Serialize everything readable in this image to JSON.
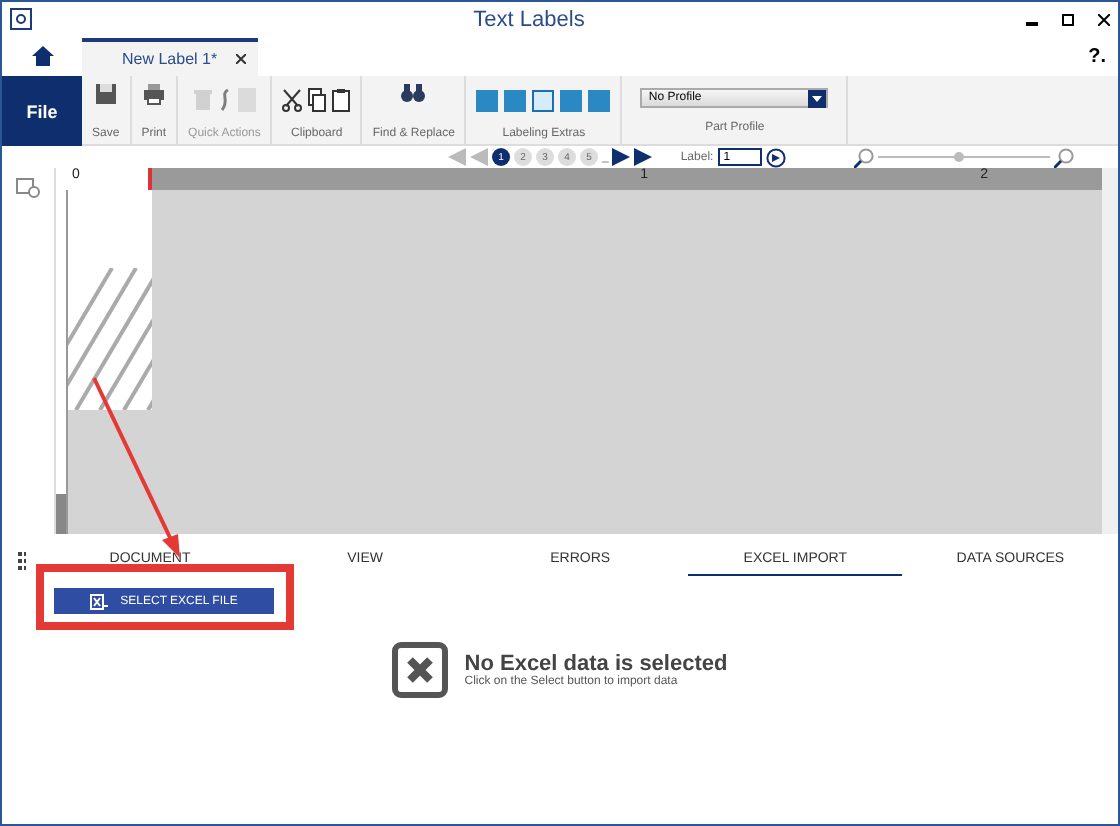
{
  "window": {
    "title": "Text Labels",
    "help": "?."
  },
  "doc_tabs": [
    {
      "label": "New Label 1*",
      "selected": true
    }
  ],
  "file_button": "File",
  "ribbon": [
    {
      "kind": "single",
      "label": "Save"
    },
    {
      "kind": "single",
      "label": "Print"
    },
    {
      "kind": "group",
      "label": "Quick Actions",
      "disabled": true
    },
    {
      "kind": "group",
      "label": "Clipboard",
      "disabled": false
    },
    {
      "kind": "single",
      "label": "Find & Replace"
    },
    {
      "kind": "extras",
      "label": "Labeling Extras",
      "items": [
        {
          "selected": false
        },
        {
          "selected": false
        },
        {
          "selected": true
        },
        {
          "selected": false
        },
        {
          "selected": false
        }
      ]
    },
    {
      "kind": "profile",
      "label": "Part Profile",
      "value": "No Profile"
    }
  ],
  "nav": {
    "pages": [
      {
        "label": "1",
        "selected": true
      },
      {
        "label": "2",
        "selected": false
      },
      {
        "label": "3",
        "selected": false
      },
      {
        "label": "4",
        "selected": false
      },
      {
        "label": "5",
        "selected": false
      }
    ],
    "more": "_",
    "label_caption": "Label:",
    "label_value": "1",
    "zoom": {
      "level": 0.47
    }
  },
  "ruler": [
    "0",
    "1",
    "2"
  ],
  "panel_tabs": [
    {
      "label": "DOCUMENT",
      "selected": false
    },
    {
      "label": "VIEW",
      "selected": false
    },
    {
      "label": "ERRORS",
      "selected": false
    },
    {
      "label": "EXCEL IMPORT",
      "selected": true
    },
    {
      "label": "DATA SOURCES",
      "selected": false
    }
  ],
  "excel": {
    "button": "SELECT EXCEL FILE",
    "title": "No Excel data is selected",
    "hint": "Click on the Select button to import data"
  }
}
